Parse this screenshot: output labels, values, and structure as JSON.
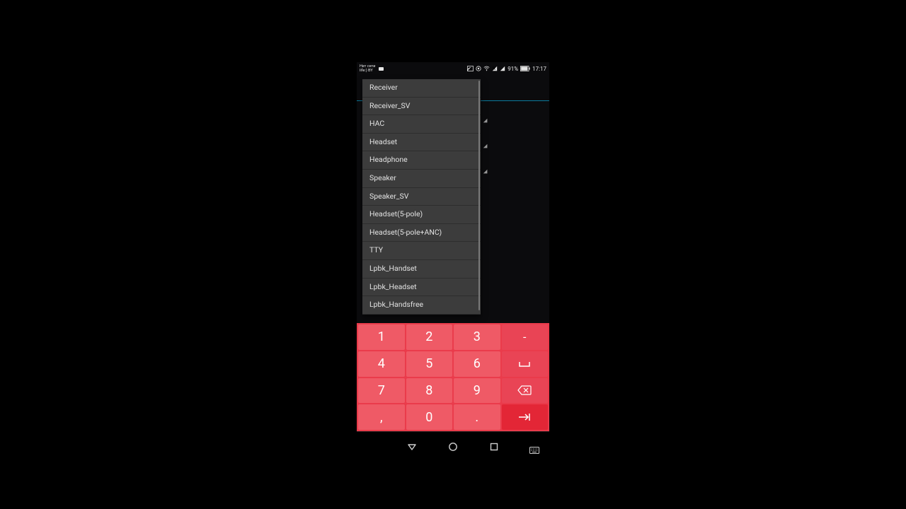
{
  "statusbar": {
    "carrier_line1": "Нет сети",
    "carrier_line2": "life:) BY",
    "battery": "91%",
    "time": "17:17"
  },
  "dropdown": {
    "items": [
      "Receiver",
      "Receiver_SV",
      "HAC",
      "Headset",
      "Headphone",
      "Speaker",
      "Speaker_SV",
      "Headset(5-pole)",
      "Headset(5-pole+ANC)",
      "TTY",
      "Lpbk_Handset",
      "Lpbk_Headset",
      "Lpbk_Handsfree"
    ]
  },
  "keypad": {
    "k1": "1",
    "k2": "2",
    "k3": "3",
    "k4": "4",
    "k5": "5",
    "k6": "6",
    "k7": "7",
    "k8": "8",
    "k9": "9",
    "k0": "0",
    "comma": ",",
    "dot": ".",
    "minus": "-",
    "space": "␣"
  }
}
